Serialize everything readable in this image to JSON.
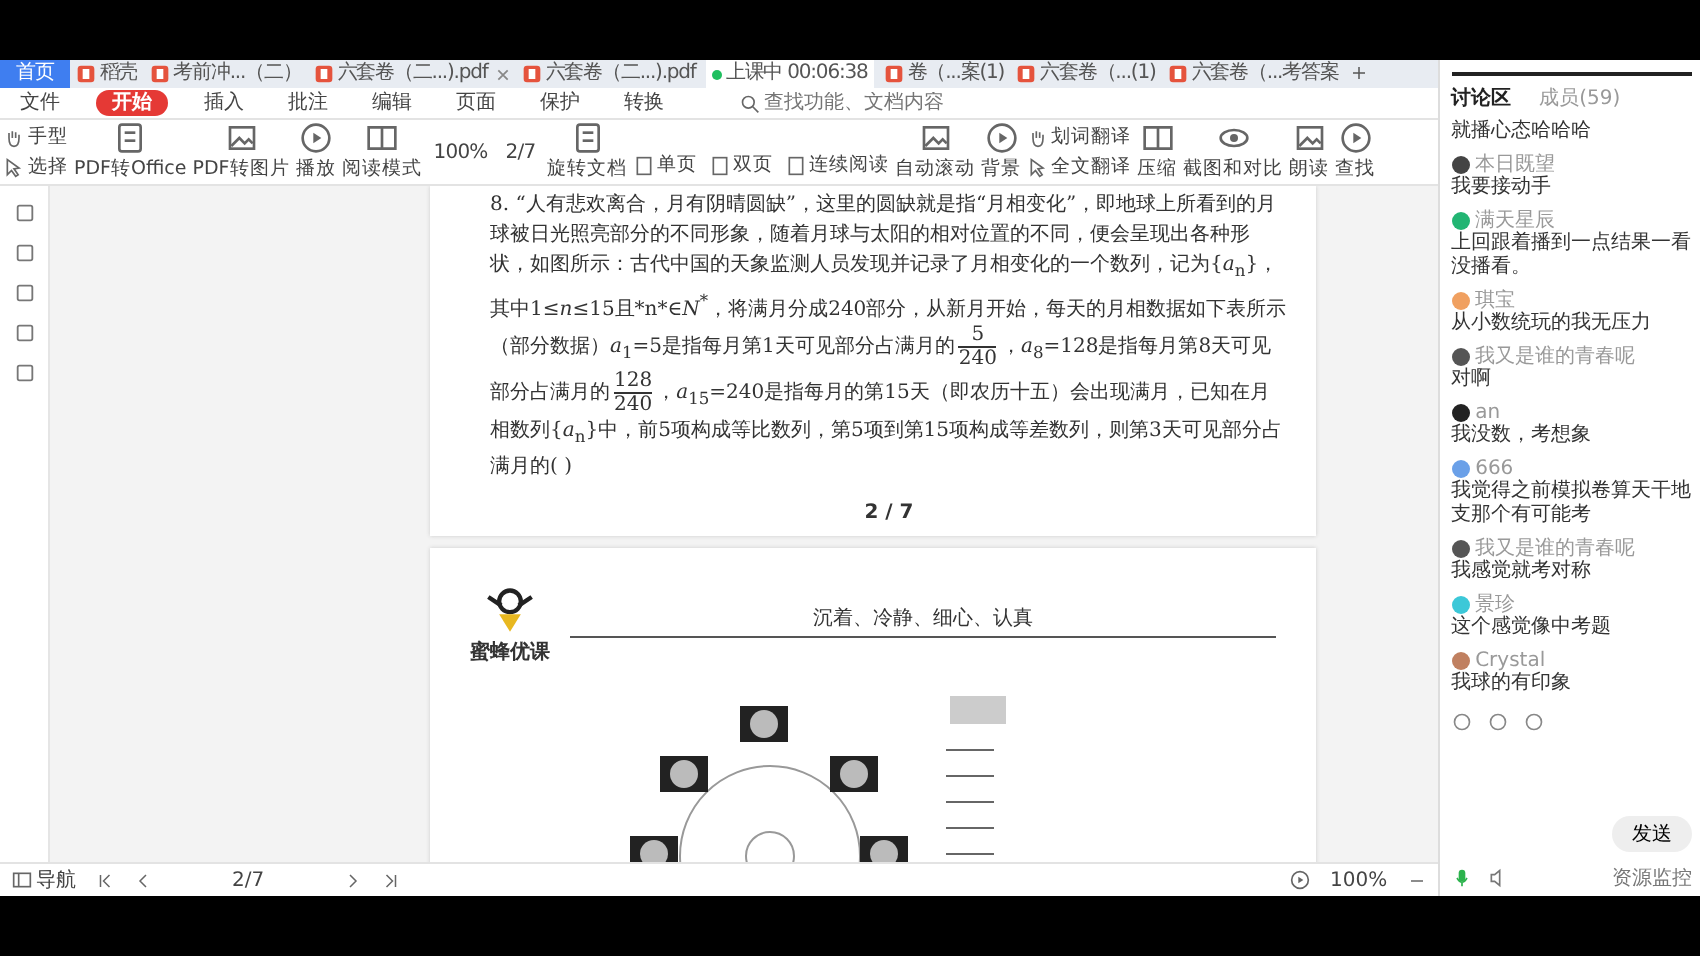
{
  "tabs": [
    {
      "label": "首页",
      "selected": true,
      "kind": "home"
    },
    {
      "label": "稻壳",
      "selected": false,
      "kind": "doc"
    },
    {
      "label": "考前冲...（二）",
      "selected": false,
      "kind": "doc"
    },
    {
      "label": "六套卷（二...).pdf",
      "selected": false,
      "kind": "doc",
      "closable": true
    },
    {
      "label": "六套卷（二...).pdf",
      "selected": false,
      "kind": "doc"
    },
    {
      "label": "上课中 00:06:38",
      "selected": false,
      "kind": "live"
    },
    {
      "label": "卷（...案(1)",
      "selected": false,
      "kind": "doc"
    },
    {
      "label": "六套卷（...(1)",
      "selected": false,
      "kind": "doc"
    },
    {
      "label": "六套卷（...考答案",
      "selected": false,
      "kind": "doc"
    }
  ],
  "menu": {
    "items": [
      {
        "label": "文件",
        "selected": false
      },
      {
        "label": "开始",
        "selected": true
      },
      {
        "label": "插入",
        "selected": false
      },
      {
        "label": "批注",
        "selected": false
      },
      {
        "label": "编辑",
        "selected": false
      },
      {
        "label": "页面",
        "selected": false
      },
      {
        "label": "保护",
        "selected": false
      },
      {
        "label": "转换",
        "selected": false
      }
    ],
    "search": {
      "placeholder": "查找功能、文档内容"
    }
  },
  "toolbar": [
    {
      "kind": "pair",
      "labels": [
        "手型",
        "选择"
      ]
    },
    {
      "kind": "big",
      "label": "PDF转Office"
    },
    {
      "kind": "big",
      "label": "PDF转图片"
    },
    {
      "kind": "big",
      "label": "播放"
    },
    {
      "kind": "big",
      "label": "阅读模式"
    },
    {
      "kind": "field",
      "label": "100%"
    },
    {
      "kind": "field",
      "label": "2/7"
    },
    {
      "kind": "big",
      "label": "旋转文档"
    },
    {
      "kind": "row",
      "labels": [
        "单页",
        "双页",
        "连续阅读"
      ]
    },
    {
      "kind": "big",
      "label": "自动滚动"
    },
    {
      "kind": "big",
      "label": "背景"
    },
    {
      "kind": "pair",
      "labels": [
        "划词翻译",
        "全文翻译"
      ]
    },
    {
      "kind": "big",
      "label": "压缩"
    },
    {
      "kind": "big",
      "label": "截图和对比"
    },
    {
      "kind": "big",
      "label": "朗读"
    },
    {
      "kind": "big",
      "label": "查找"
    }
  ],
  "document": {
    "question": [
      {
        "kind": "text",
        "text": "8. “人有悲欢离合，月有阴晴圆缺”，这里的圆缺就是指“月相变化”，即地球上所看到的月球被日光照亮部分的不同形象，随着月球与太阳的相对位置的不同，便会呈现出各种形状，如图所示：古代中国的天象监测人员发现并记录了月相变化的一个数列，记为{*a*$_{n}$}，其中1≤*n*≤15且*n*∈*N*$^{*}$，将满月分成240部分，从新月开始，每天的月相数据如下表所示（部分数据）*a*$_{1}$=5是指每月第1天可见部分占满月的"
      },
      {
        "kind": "fraction",
        "numerator": "5",
        "denominator": "240"
      },
      {
        "kind": "text",
        "text": "，*a*$_{8}$=128是指每月第8天可见部分占满月的"
      },
      {
        "kind": "fraction",
        "numerator": "128",
        "denominator": "240"
      },
      {
        "kind": "text",
        "text": "，*a*$_{15}$=240是指每月的第15天（即农历十五）会出现满月，已知在月相数列{*a*$_{n}$}中，前5项构成等比数列，第5项到第15项构成等差数列，则第3天可见部分占满月的(      )"
      }
    ],
    "page_number": "2 / 7",
    "next_page": {
      "logo_text": "蜜蜂优课",
      "motto": "沉着、冷静、细心、认真"
    }
  },
  "status_bar": {
    "nav": "导航",
    "page": "2/7",
    "zoom": "100%"
  },
  "chat": {
    "tabs": [
      {
        "label": "讨论区",
        "selected": true
      },
      {
        "label": "成员(59)",
        "selected": false
      }
    ],
    "messages": [
      {
        "text": "就播心态哈哈哈"
      },
      {
        "name": "本日既望",
        "color": "#444444",
        "text": "我要接动手"
      },
      {
        "name": "满天星辰",
        "color": "#22b573",
        "text": "上回跟着播到一点结果一看没播看。"
      },
      {
        "name": "琪宝",
        "color": "#f0a060",
        "text": "从小数统玩的我无压力"
      },
      {
        "name": "我又是谁的青春呢",
        "color": "#555555",
        "text": "对啊"
      },
      {
        "name": "an",
        "color": "#222222",
        "text": "我没数，考想象"
      },
      {
        "name": "666",
        "color": "#6aa0e8",
        "text": "我觉得之前模拟卷算天干地支那个有可能考"
      },
      {
        "name": "我又是谁的青春呢",
        "color": "#555555",
        "text": "我感觉就考对称"
      },
      {
        "name": "景珍",
        "color": "#3cc8d8",
        "text": "这个感觉像中考题"
      },
      {
        "name": "Crystal",
        "color": "#c08060",
        "text": "我球的有印象"
      }
    ],
    "send": "发送",
    "monitor": "资源监控"
  }
}
